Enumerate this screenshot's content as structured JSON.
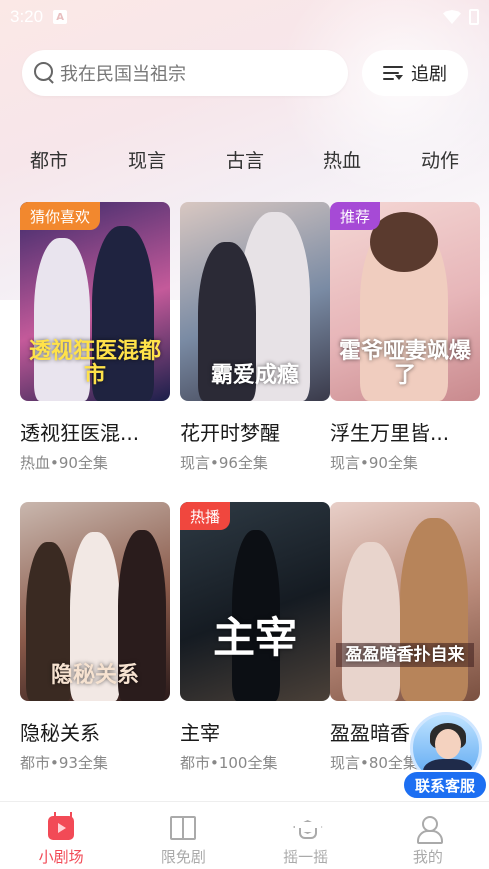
{
  "status_bar": {
    "time": "3:20",
    "notification_badge": "A"
  },
  "search": {
    "placeholder": "我在民国当祖宗"
  },
  "follow_button": {
    "label": "追剧"
  },
  "categories": [
    "都市",
    "现言",
    "古言",
    "热血",
    "动作"
  ],
  "dramas": [
    {
      "name": "透视狂医混...",
      "meta": "热血•90全集",
      "tag": "猜你喜欢",
      "tag_color": "#f2882e",
      "poster_title": "透视狂医混都市",
      "poster_colors": [
        "#3a2a6a",
        "#c45a9a",
        "#1b1f4a"
      ]
    },
    {
      "name": "花开时梦醒",
      "meta": "现言•96全集",
      "tag": "",
      "tag_color": "",
      "poster_title": "霸爱成瘾",
      "poster_colors": [
        "#d8c7c1",
        "#7a8ba4",
        "#3a3a4a"
      ]
    },
    {
      "name": "浮生万里皆...",
      "meta": "现言•90全集",
      "tag": "推荐",
      "tag_color": "#a64ad6",
      "poster_title": "霍爷哑妻飒爆了",
      "poster_colors": [
        "#f4d7d4",
        "#e7b6b9",
        "#c98a8e"
      ]
    },
    {
      "name": "隐秘关系",
      "meta": "都市•93全集",
      "tag": "",
      "tag_color": "",
      "poster_title": "隐秘关系",
      "poster_colors": [
        "#c9b7ae",
        "#8a5a4a",
        "#2a1a1a"
      ]
    },
    {
      "name": "主宰",
      "meta": "都市•100全集",
      "tag": "热播",
      "tag_color": "#f0473e",
      "poster_title": "主宰",
      "poster_colors": [
        "#2e3a44",
        "#151b22",
        "#4a4038"
      ]
    },
    {
      "name": "盈盈暗香",
      "meta": "现言•80全集",
      "tag": "",
      "tag_color": "",
      "poster_title": "盈盈暗香扑自来",
      "poster_colors": [
        "#e8cfc8",
        "#b98a7a",
        "#7a5040"
      ]
    }
  ],
  "service": {
    "label": "联系客服"
  },
  "bottom_nav": [
    {
      "label": "小剧场",
      "icon": "tv-icon",
      "active": true
    },
    {
      "label": "限免剧",
      "icon": "book-icon",
      "active": false
    },
    {
      "label": "摇一摇",
      "icon": "graduation-cap-icon",
      "active": false
    },
    {
      "label": "我的",
      "icon": "user-icon",
      "active": false
    }
  ],
  "colors": {
    "accent": "#f24a56",
    "service_blue": "#1d6ff2"
  }
}
